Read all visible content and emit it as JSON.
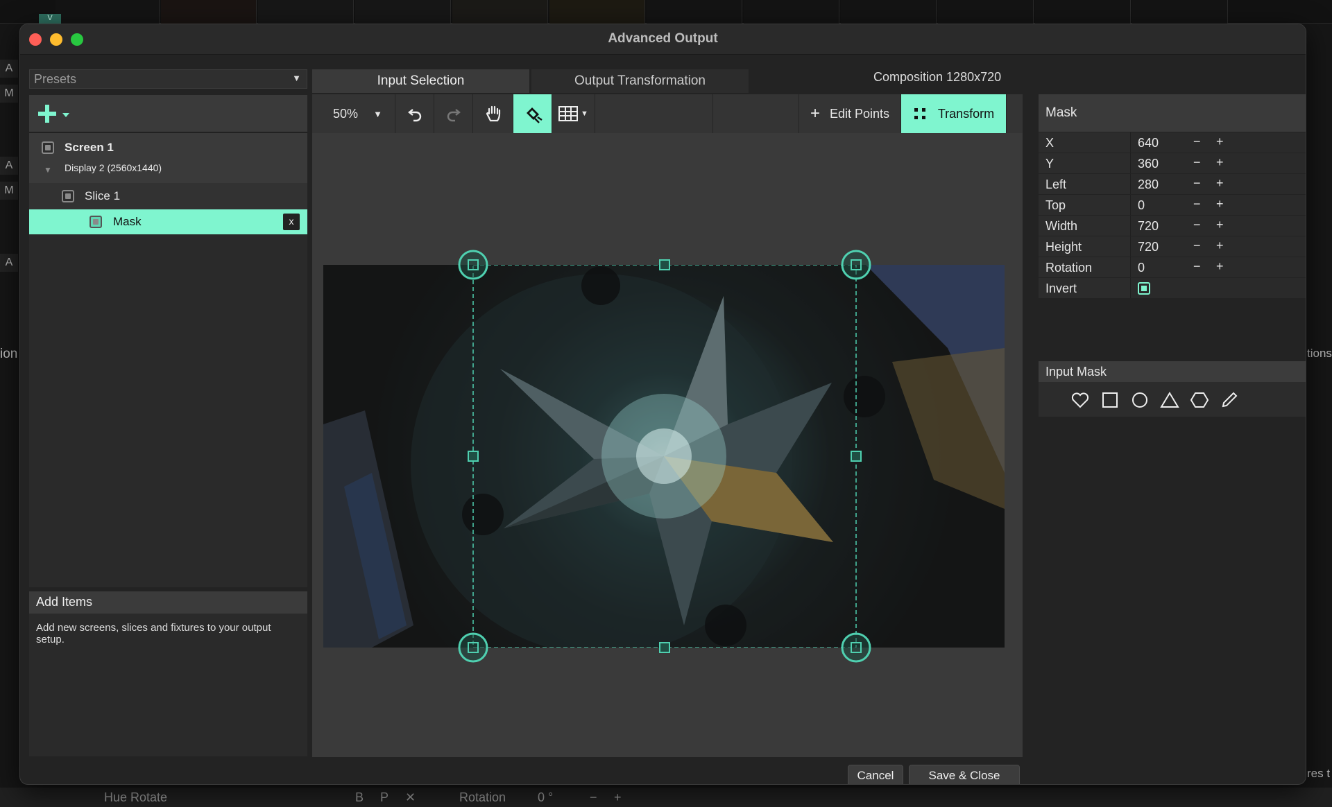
{
  "background": {
    "letters": [
      "A",
      "M",
      "A",
      "M",
      "A"
    ],
    "bottom_bar": {
      "hue_rotate": "Hue Rotate",
      "b": "B",
      "p": "P",
      "x": "✕",
      "rotation": "Rotation",
      "rotation_value": "0 °",
      "minus": "−",
      "plus": "+"
    },
    "side_right_1": "tions",
    "side_right_2": "res t",
    "side_left_1": "ion",
    "v_badge": "V"
  },
  "window": {
    "title": "Advanced Output",
    "colors": {
      "accent": "#7ff5cf",
      "close": "#fe5f57",
      "minimize": "#febc2e",
      "zoom": "#28c840"
    }
  },
  "left": {
    "presets": "Presets",
    "add_icon": "plus-icon",
    "tree": {
      "screen": "Screen 1",
      "display": "Display 2 (2560x1440)",
      "slice": "Slice 1",
      "mask": "Mask",
      "mask_close": "x"
    },
    "add_items": {
      "title": "Add Items",
      "description": "Add new screens, slices and fixtures to your output setup."
    }
  },
  "tabs": {
    "input_selection": "Input Selection",
    "output_transformation": "Output Transformation",
    "composition": "Composition 1280x720"
  },
  "toolbar": {
    "zoom": "50%",
    "edit_points": "Edit Points",
    "transform": "Transform"
  },
  "mask_panel": {
    "title": "Mask",
    "minus": "−",
    "plus": "+",
    "params": {
      "x": {
        "label": "X",
        "value": "640"
      },
      "y": {
        "label": "Y",
        "value": "360"
      },
      "left": {
        "label": "Left",
        "value": "280"
      },
      "top": {
        "label": "Top",
        "value": "0"
      },
      "width": {
        "label": "Width",
        "value": "720"
      },
      "height": {
        "label": "Height",
        "value": "720"
      },
      "rotation": {
        "label": "Rotation",
        "value": "0"
      }
    },
    "invert": {
      "label": "Invert",
      "checked": true
    },
    "input_mask": {
      "title": "Input Mask",
      "shapes": [
        "heart-icon",
        "square-icon",
        "circle-icon",
        "triangle-icon",
        "hexagon-icon",
        "pencil-icon"
      ]
    }
  },
  "footer": {
    "cancel": "Cancel",
    "save_close": "Save & Close"
  }
}
